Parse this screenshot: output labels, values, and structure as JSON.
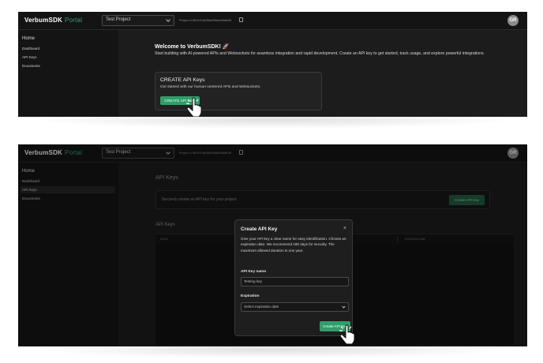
{
  "app": {
    "logo": "VerbumSDK",
    "logo_suffix": "Portal",
    "project_select": "Test Project",
    "project_id": "Project # 6b01f7a839a0f96a0b5a698",
    "avatar_initials": "GR"
  },
  "sidebar": {
    "home": "Home",
    "items": [
      "Dashboard",
      "API Keys",
      "Documents"
    ]
  },
  "screen1": {
    "welcome_title": "Welcome to VerbumSDK! 🚀",
    "welcome_desc": "Start building with AI-powered APIs and Websockets for seamless integration and rapid development. Create an API key to get started, track usage, and explore powerful integrations.",
    "card_title": "CREATE API Keys",
    "card_desc": "Get started with our human-centered APIs and Websockets.",
    "card_button": "CREATE API KEY"
  },
  "screen2": {
    "page_title": "API Keys",
    "secure_text": "Securely create an API key for your project",
    "create_button": "Create API Key",
    "table_title": "API Keys",
    "table_headers": [
      "Name",
      "Key",
      "Expiration Date"
    ]
  },
  "modal": {
    "title": "Create API Key",
    "close": "×",
    "description": "Give your API key a clear name for easy identification. Choose an expiration date. We recommend 180 days for security. The maximum allowed duration is one year.",
    "name_label": "API Key name",
    "name_value": "Testing key",
    "expiration_label": "Expiration",
    "expiration_placeholder": "Select expiration date",
    "submit": "Create API Key"
  },
  "colors": {
    "accent": "#2f9e6a",
    "background": "#1c1c1c",
    "sidebar": "#141414"
  }
}
